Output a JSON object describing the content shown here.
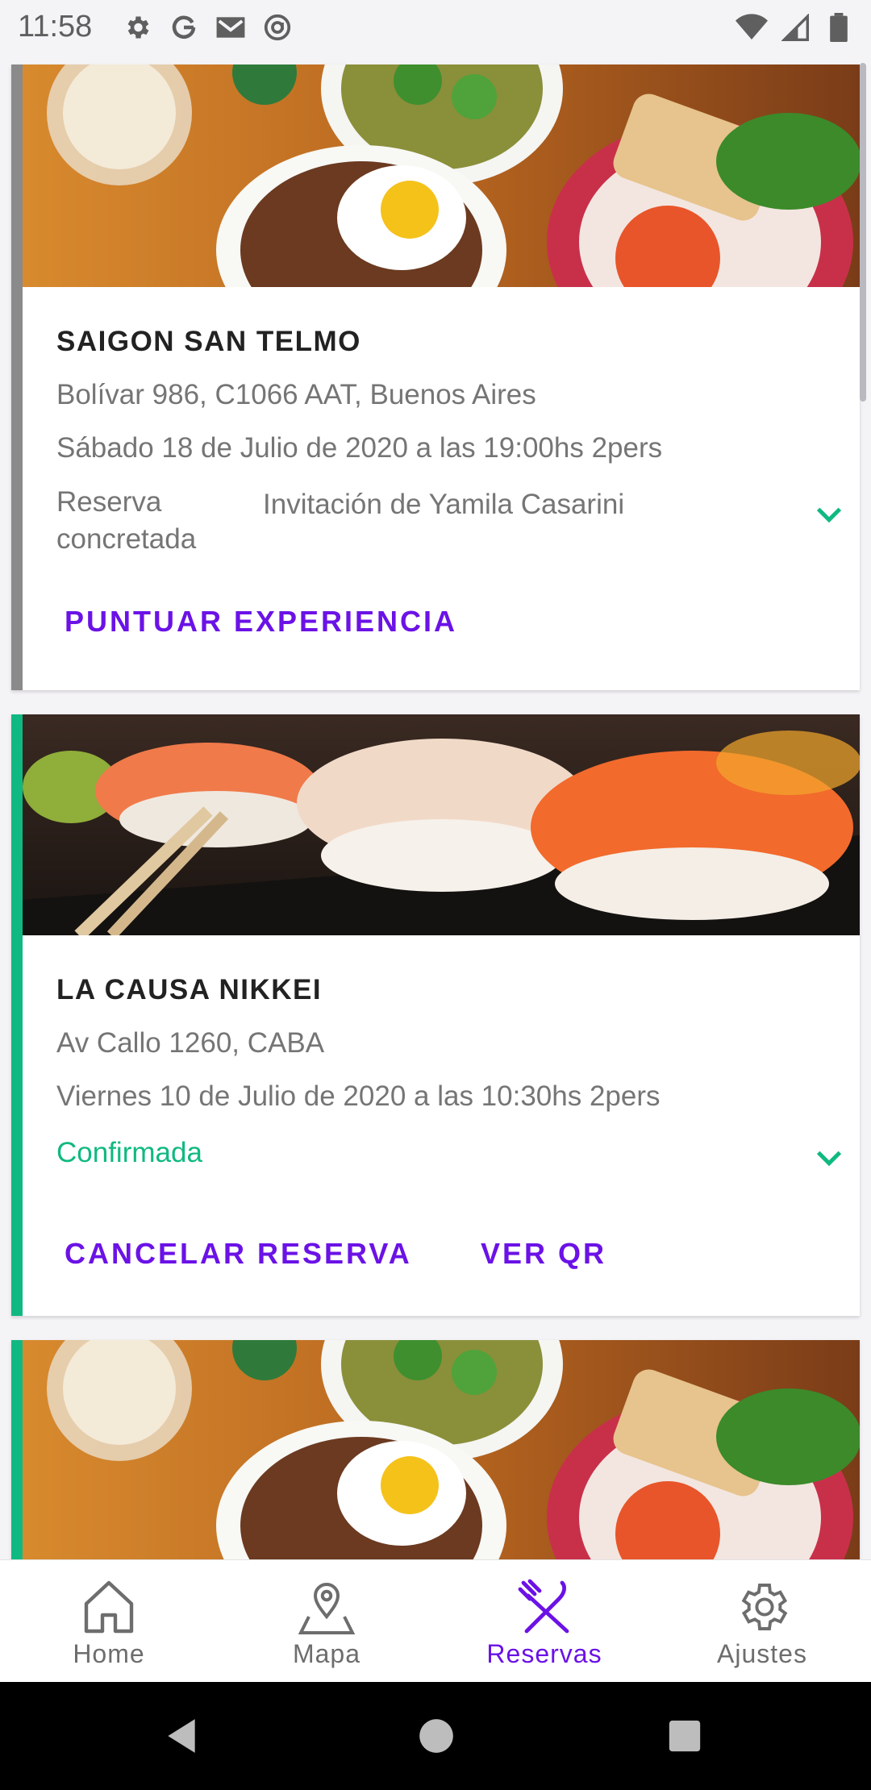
{
  "status_bar": {
    "time": "11:58",
    "left_icons": [
      "gear-icon",
      "google-icon",
      "gmail-icon",
      "at-sign-icon"
    ],
    "right_icons": [
      "wifi-icon",
      "signal-icon",
      "battery-icon"
    ]
  },
  "reservations": [
    {
      "name": "SAIGON SAN TELMO",
      "address": "Bolívar 986, C1066 AAT, Buenos Aires",
      "datetime": "Sábado 18 de Julio de 2020 a las 19:00hs 2pers",
      "status": "Reserva concretada",
      "status_color": "#757575",
      "accent_color": "#8a8a8a",
      "invitation": "Invitación de Yamila Casarini",
      "actions": [
        "PUNTUAR EXPERIENCIA"
      ]
    },
    {
      "name": "LA CAUSA NIKKEI",
      "address": "Av Callo 1260, CABA",
      "datetime": "Viernes 10 de Julio de 2020 a las 10:30hs 2pers",
      "status": "Confirmada",
      "status_color": "#10b981",
      "accent_color": "#10b981",
      "actions": [
        "CANCELAR RESERVA",
        "VER QR"
      ]
    }
  ],
  "bottom_nav": {
    "items": [
      {
        "label": "Home",
        "icon": "home-icon"
      },
      {
        "label": "Mapa",
        "icon": "map-pin-icon"
      },
      {
        "label": "Reservas",
        "icon": "fork-knife-icon",
        "active": true
      },
      {
        "label": "Ajustes",
        "icon": "gear-icon"
      }
    ]
  },
  "colors": {
    "accent": "#6b12e6",
    "confirmed": "#10b981"
  }
}
